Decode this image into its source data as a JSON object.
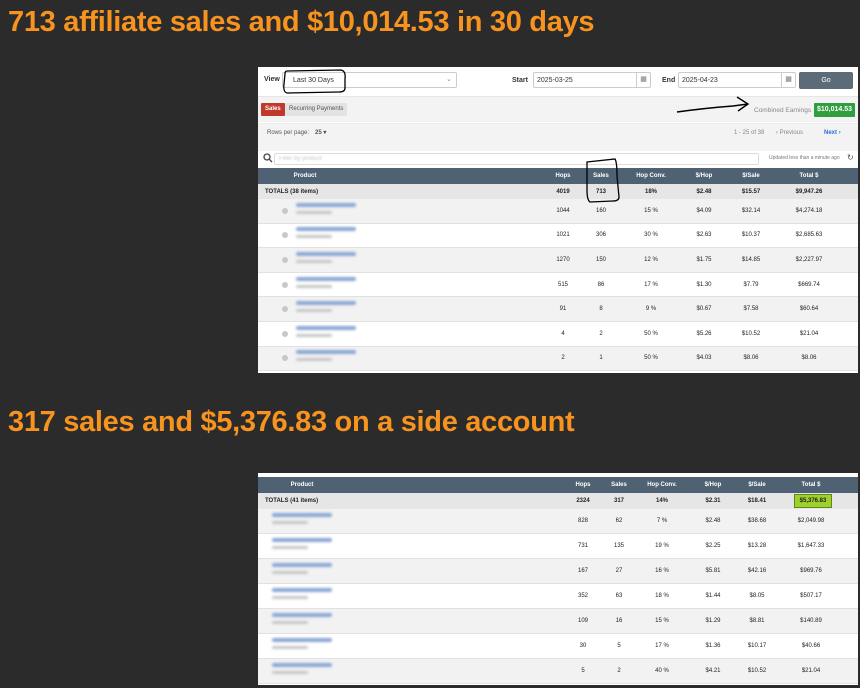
{
  "headings": {
    "first": "713 affiliate sales and $10,014.53 in 30 days",
    "second": "317 sales and $5,376.83 on a side account"
  },
  "panel1": {
    "filters": {
      "view_label": "View",
      "view_value": "Last 30 Days",
      "start_label": "Start",
      "start_value": "2025-03-25",
      "end_label": "End",
      "end_value": "2025-04-23",
      "go_label": "Go"
    },
    "tabs": {
      "sales": "Sales",
      "recurring": "Recurring Payments"
    },
    "combined_label": "Combined Earnings",
    "combined_value": "$10,014.53",
    "pager": {
      "rows_label": "Rows per page:",
      "rows_value": "25",
      "range": "1 - 25 of 38",
      "previous": "Previous",
      "next": "Next"
    },
    "search_placeholder": "Filter by product",
    "updated": "Updated less than a minute ago",
    "columns": [
      "Product",
      "Hops",
      "Sales",
      "Hop Conv.",
      "$/Hop",
      "$/Sale",
      "Total $"
    ],
    "totals": {
      "label": "TOTALS (38 items)",
      "hops": "4019",
      "sales": "713",
      "conv": "18%",
      "per_hop": "$2.48",
      "per_sale": "$15.57",
      "total": "$9,947.26"
    },
    "rows": [
      {
        "hops": "1044",
        "sales": "160",
        "conv": "15 %",
        "per_hop": "$4.09",
        "per_sale": "$32.14",
        "total": "$4,274.18"
      },
      {
        "hops": "1021",
        "sales": "306",
        "conv": "30 %",
        "per_hop": "$2.63",
        "per_sale": "$10.37",
        "total": "$2,685.63"
      },
      {
        "hops": "1270",
        "sales": "150",
        "conv": "12 %",
        "per_hop": "$1.75",
        "per_sale": "$14.85",
        "total": "$2,227.97"
      },
      {
        "hops": "515",
        "sales": "86",
        "conv": "17 %",
        "per_hop": "$1.30",
        "per_sale": "$7.79",
        "total": "$669.74"
      },
      {
        "hops": "91",
        "sales": "8",
        "conv": "9 %",
        "per_hop": "$0.67",
        "per_sale": "$7.58",
        "total": "$60.64"
      },
      {
        "hops": "4",
        "sales": "2",
        "conv": "50 %",
        "per_hop": "$5.26",
        "per_sale": "$10.52",
        "total": "$21.04"
      },
      {
        "hops": "2",
        "sales": "1",
        "conv": "50 %",
        "per_hop": "$4.03",
        "per_sale": "$8.06",
        "total": "$8.06"
      }
    ]
  },
  "panel2": {
    "columns": [
      "Product",
      "Hops",
      "Sales",
      "Hop Conv.",
      "$/Hop",
      "$/Sale",
      "Total $"
    ],
    "totals": {
      "label": "TOTALS (41 items)",
      "hops": "2324",
      "sales": "317",
      "conv": "14%",
      "per_hop": "$2.31",
      "per_sale": "$18.41",
      "total": "$5,376.83"
    },
    "rows": [
      {
        "hops": "828",
        "sales": "62",
        "conv": "7 %",
        "per_hop": "$2.48",
        "per_sale": "$38.68",
        "total": "$2,049.98"
      },
      {
        "hops": "731",
        "sales": "135",
        "conv": "19 %",
        "per_hop": "$2.25",
        "per_sale": "$13.28",
        "total": "$1,647.33"
      },
      {
        "hops": "167",
        "sales": "27",
        "conv": "16 %",
        "per_hop": "$5.81",
        "per_sale": "$42.16",
        "total": "$969.76"
      },
      {
        "hops": "352",
        "sales": "63",
        "conv": "18 %",
        "per_hop": "$1.44",
        "per_sale": "$8.05",
        "total": "$507.17"
      },
      {
        "hops": "109",
        "sales": "16",
        "conv": "15 %",
        "per_hop": "$1.29",
        "per_sale": "$8.81",
        "total": "$140.89"
      },
      {
        "hops": "30",
        "sales": "5",
        "conv": "17 %",
        "per_hop": "$1.36",
        "per_sale": "$10.17",
        "total": "$40.66"
      },
      {
        "hops": "5",
        "sales": "2",
        "conv": "40 %",
        "per_hop": "$4.21",
        "per_sale": "$10.52",
        "total": "$21.04"
      }
    ]
  },
  "colors": {
    "heading": "#f7931e",
    "header_bg": "#4f6274",
    "sales_tab": "#c0392b",
    "earnings_badge": "#2e9e3e",
    "total_highlight": "#9fd12a"
  }
}
